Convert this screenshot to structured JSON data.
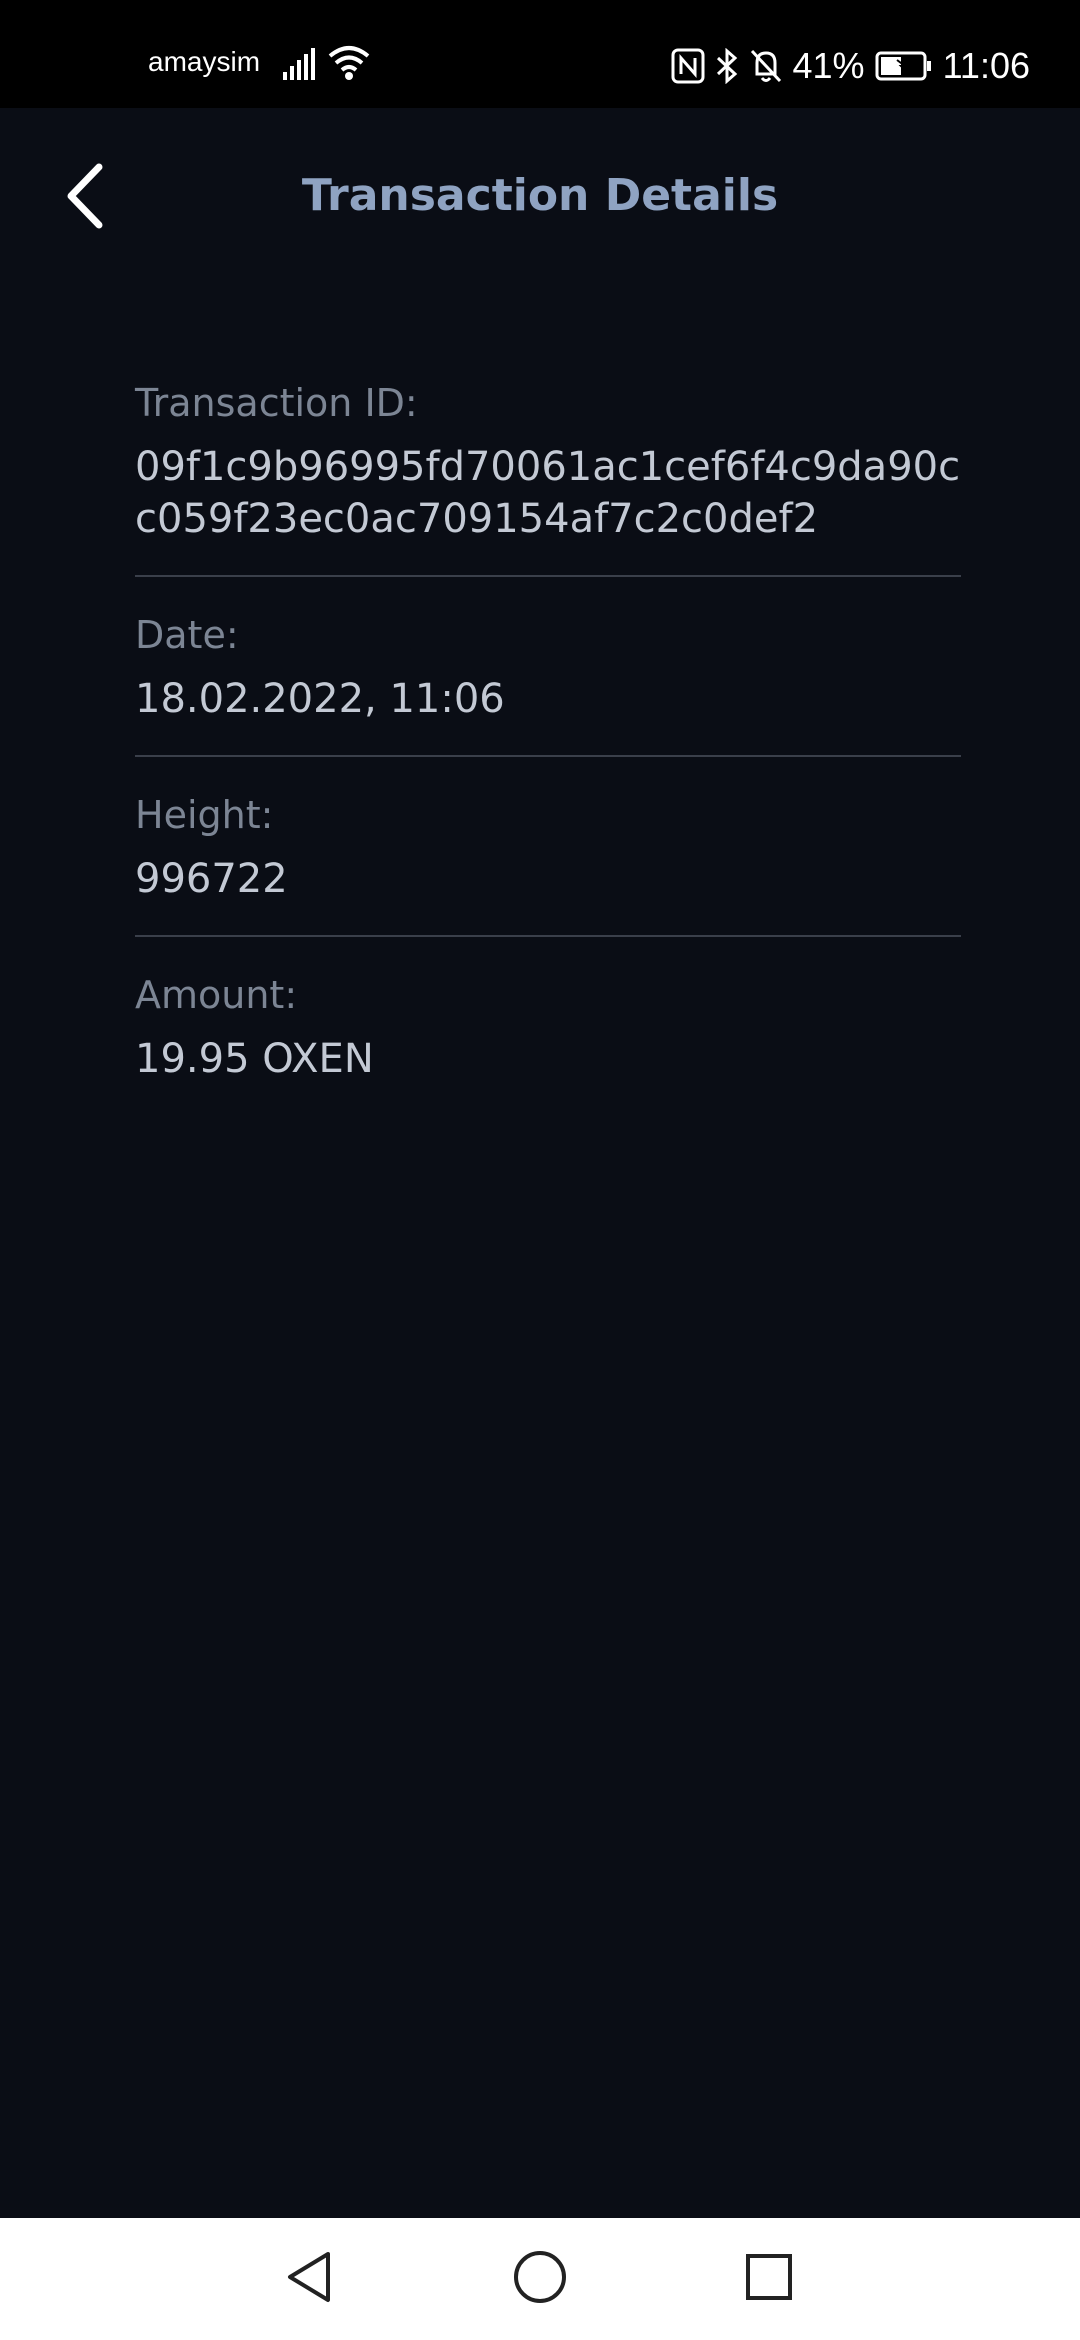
{
  "status_bar": {
    "carrier": "amaysim",
    "battery": "41%",
    "time": "11:06",
    "icons": [
      "signal-icon",
      "wifi-icon",
      "nfc-icon",
      "bluetooth-icon",
      "bell-off-icon",
      "battery-icon"
    ]
  },
  "header": {
    "title": "Transaction Details",
    "back_icon": "chevron-left-icon"
  },
  "details": {
    "transaction_id_label": "Transaction ID:",
    "transaction_id_value": "09f1c9b96995fd70061ac1cef6f4c9da90cc059f23ec0ac709154af7c2c0def2",
    "date_label": "Date:",
    "date_value": "18.02.2022, 11:06",
    "height_label": "Height:",
    "height_value": "996722",
    "amount_label": "Amount:",
    "amount_value": "19.95 OXEN"
  },
  "nav_bar": {
    "icons": [
      "back-triangle-icon",
      "home-circle-icon",
      "recents-square-icon"
    ]
  },
  "colors": {
    "background": "#0a0d15",
    "title": "#8fa3c2",
    "label": "#7c8594",
    "value": "#c3c9d4",
    "divider": "#3a3f4a"
  }
}
